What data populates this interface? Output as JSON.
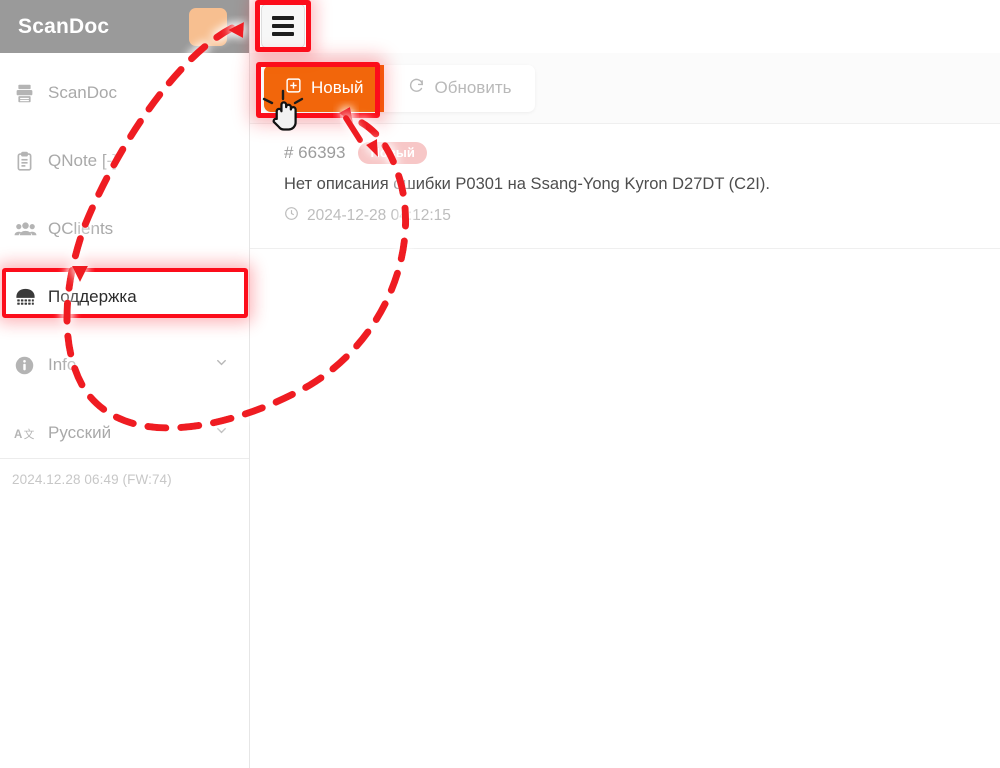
{
  "app": {
    "title": "ScanDoc"
  },
  "sidebar": {
    "header_title": "ScanDoc",
    "header_button_icon": "orange-square-button",
    "items": [
      {
        "label": "ScanDoc",
        "icon": "scanner-icon",
        "active": false,
        "chevron": false
      },
      {
        "label": "QNote [-]",
        "icon": "clipboard-icon",
        "active": false,
        "chevron": false
      },
      {
        "label": "QClients",
        "icon": "users-icon",
        "active": false,
        "chevron": false
      },
      {
        "label": "Поддержка",
        "icon": "headset-icon",
        "active": true,
        "chevron": false
      },
      {
        "label": "Info",
        "icon": "info-icon",
        "active": false,
        "chevron": true
      },
      {
        "label": "Русский",
        "icon": "translate-icon",
        "active": false,
        "chevron": true
      }
    ],
    "footer_text": "2024.12.28 06:49 (FW:74)"
  },
  "topbar": {
    "menu_icon": "hamburger-menu-icon"
  },
  "toolbar": {
    "new_label": "Новый",
    "new_icon": "plus-square-icon",
    "refresh_label": "Обновить",
    "refresh_icon": "refresh-icon"
  },
  "tickets": [
    {
      "id": "# 66393",
      "badge": "Новый",
      "title": "Нет описания ошибки P0301 на Ssang-Yong Kyron D27DT (C2I).",
      "time": "2024-12-28 04:12:15",
      "clock_icon": "clock-icon"
    }
  ],
  "annotations": {
    "highlight_color": "#fc0d1b",
    "accent_orange": "#f2660b",
    "header_gray": "#9a9a9a"
  }
}
